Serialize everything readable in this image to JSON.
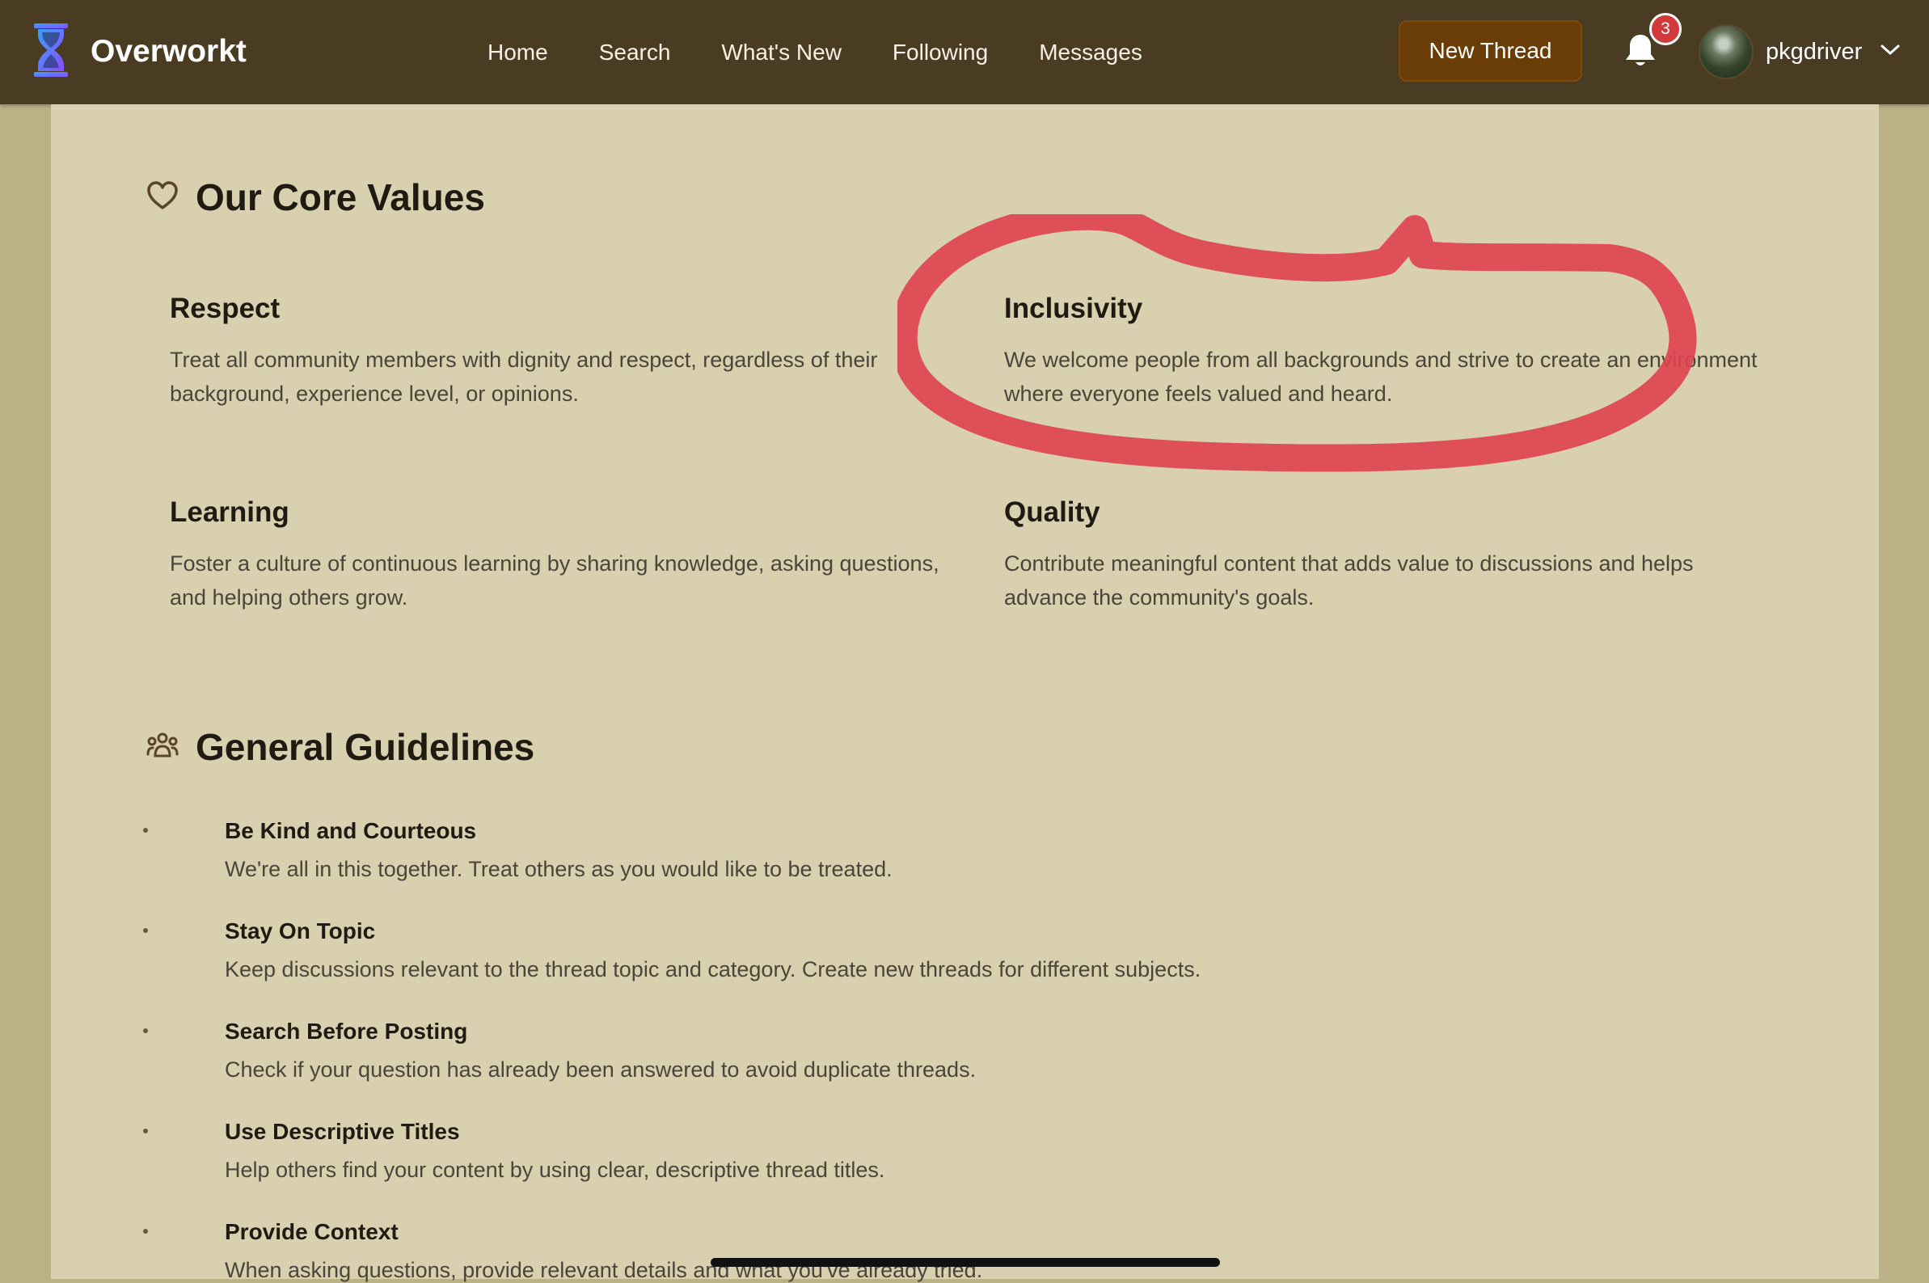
{
  "brand": {
    "name": "Overworkt",
    "icon": "hourglass-icon"
  },
  "nav": {
    "links": [
      "Home",
      "Search",
      "What's New",
      "Following",
      "Messages"
    ]
  },
  "actions": {
    "new_thread_label": "New Thread",
    "notifications_count": "3",
    "username": "pkgdriver"
  },
  "core_values": {
    "title": "Our Core Values",
    "icon": "heart-icon",
    "items": [
      {
        "title": "Respect",
        "text": "Treat all community members with dignity and respect, regardless of their background, experience level, or opinions."
      },
      {
        "title": "Inclusivity",
        "text": "We welcome people from all backgrounds and strive to create an environment where everyone feels valued and heard."
      },
      {
        "title": "Learning",
        "text": "Foster a culture of continuous learning by sharing knowledge, asking questions, and helping others grow."
      },
      {
        "title": "Quality",
        "text": "Contribute meaningful content that adds value to discussions and helps advance the community's goals."
      }
    ]
  },
  "guidelines": {
    "title": "General Guidelines",
    "icon": "users-icon",
    "items": [
      {
        "title": "Be Kind and Courteous",
        "text": "We're all in this together. Treat others as you would like to be treated."
      },
      {
        "title": "Stay On Topic",
        "text": "Keep discussions relevant to the thread topic and category. Create new threads for different subjects."
      },
      {
        "title": "Search Before Posting",
        "text": "Check if your question has already been answered to avoid duplicate threads."
      },
      {
        "title": "Use Descriptive Titles",
        "text": "Help others find your content by using clear, descriptive thread titles."
      },
      {
        "title": "Provide Context",
        "text": "When asking questions, provide relevant details and what you've already tried."
      }
    ]
  },
  "colors": {
    "topbar": "#4a3b23",
    "page": "#d8d0ae",
    "accent_button": "#6b3d06",
    "annotation": "#e0404f"
  }
}
